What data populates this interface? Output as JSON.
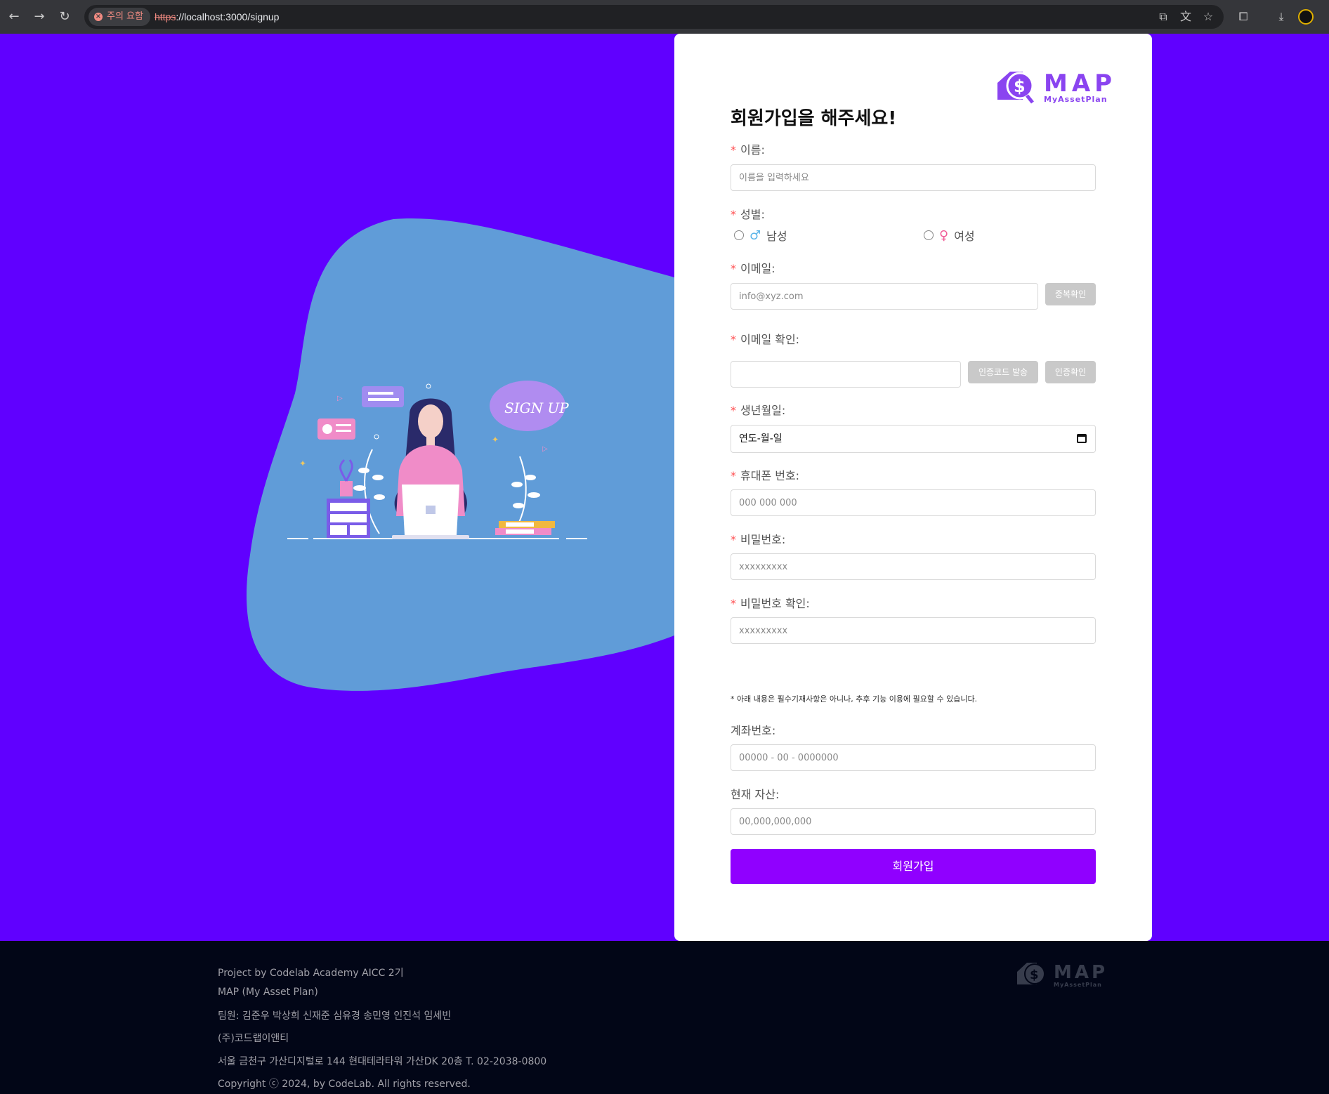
{
  "browser": {
    "security_label": "주의 요함",
    "url_protocol": "https",
    "url_rest": "://localhost:3000/signup"
  },
  "illustration": {
    "sign_up_text": "SIGN UP"
  },
  "logo": {
    "name": "MAP",
    "tagline": "MyAssetPlan"
  },
  "form": {
    "title": "회원가입을 해주세요!",
    "name_label": "이름:",
    "name_placeholder": "이름을 입력하세요",
    "gender_label": "성별:",
    "gender_options": [
      {
        "symbol": "♂",
        "label": "남성"
      },
      {
        "symbol": "♀",
        "label": "여성"
      }
    ],
    "email_label": "이메일:",
    "email_placeholder": "info@xyz.com",
    "email_check_button": "중복확인",
    "email_verify_label": "이메일 확인:",
    "send_code_button": "인증코드 발송",
    "verify_code_button": "인증확인",
    "birth_label": "생년월일:",
    "birth_placeholder": "연도-월-일",
    "phone_label": "휴대폰 번호:",
    "phone_placeholder": "000 000 000",
    "password_label": "비밀번호:",
    "password_placeholder": "xxxxxxxxx",
    "password_confirm_label": "비밀번호 확인:",
    "password_confirm_placeholder": "xxxxxxxxx",
    "optional_note": "* 아래 내용은 필수기재사항은 아니나, 추후 기능 이용에 필요할 수 있습니다.",
    "account_label": "계좌번호:",
    "account_placeholder": "00000 - 00 - 0000000",
    "assets_label": "현재 자산:",
    "assets_placeholder": "00,000,000,000",
    "submit_button": "회원가입",
    "required_mark": "*"
  },
  "footer": {
    "lines": [
      "Project by Codelab Academy AICC 2기",
      "MAP (My Asset Plan)",
      "팀원: 김준우 박상희 신재준 심유경 송민영 인진석 임세빈",
      "(주)코드랩이앤티",
      "서울 금천구 가산디지털로 144 현대테라타워 가산DK 20층 T. 02-2038-0800",
      "Copyright ⓒ 2024, by CodeLab. All rights reserved."
    ]
  },
  "colors": {
    "page_background": "#6000ff",
    "blob": "#609cd8",
    "submit": "#9000ff",
    "logo": "#8a44f0",
    "footer": "#020617"
  }
}
